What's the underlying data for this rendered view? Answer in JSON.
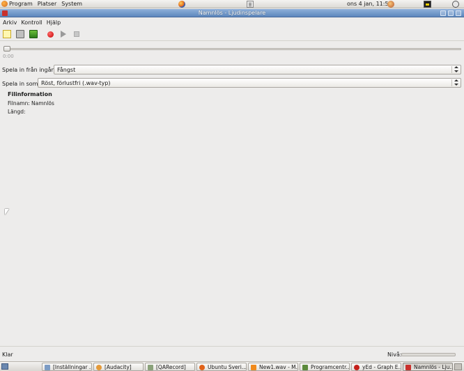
{
  "top_panel": {
    "menus": [
      "Program",
      "Platser",
      "System"
    ],
    "clock": "ons  4 jan, 11:50"
  },
  "window": {
    "title": "Namnlös - Ljudinspelare"
  },
  "menubar": [
    "Arkiv",
    "Kontroll",
    "Hjälp"
  ],
  "player": {
    "time": "0:00"
  },
  "form": {
    "input_label": "Spela in från ingång:",
    "input_value": "Fångst",
    "format_label": "Spela in som:",
    "format_value": "Röst, förlustfri (.wav-typ)"
  },
  "file_info": {
    "heading": "Filinformation",
    "name_label": "Filnamn:",
    "name_value": "Namnlös",
    "length_label": "Längd:"
  },
  "statusbar": {
    "status": "Klar",
    "level_label": "Nivå:",
    "level": 0
  },
  "taskbar": {
    "tasks": [
      {
        "label": "[Inställningar ..."
      },
      {
        "label": "[Audacity]"
      },
      {
        "label": "[QARecord]"
      },
      {
        "label": "Ubuntu Sveri..."
      },
      {
        "label": "New1.wav - M..."
      },
      {
        "label": "Programcentr..."
      },
      {
        "label": "yEd - Graph E..."
      },
      {
        "label": "Namnlös - Lju..."
      }
    ]
  },
  "icons": {
    "menu_icon": "gnome-foot-icon",
    "browser_icon": "firefox-icon",
    "notes_icon": "notes-icon",
    "user_icon": "user-icon",
    "mail_icon": "mail-icon",
    "power_icon": "power-icon",
    "toolbar": [
      "new-icon",
      "open-icon",
      "save-icon",
      "record-icon",
      "play-icon",
      "stop-icon"
    ]
  }
}
